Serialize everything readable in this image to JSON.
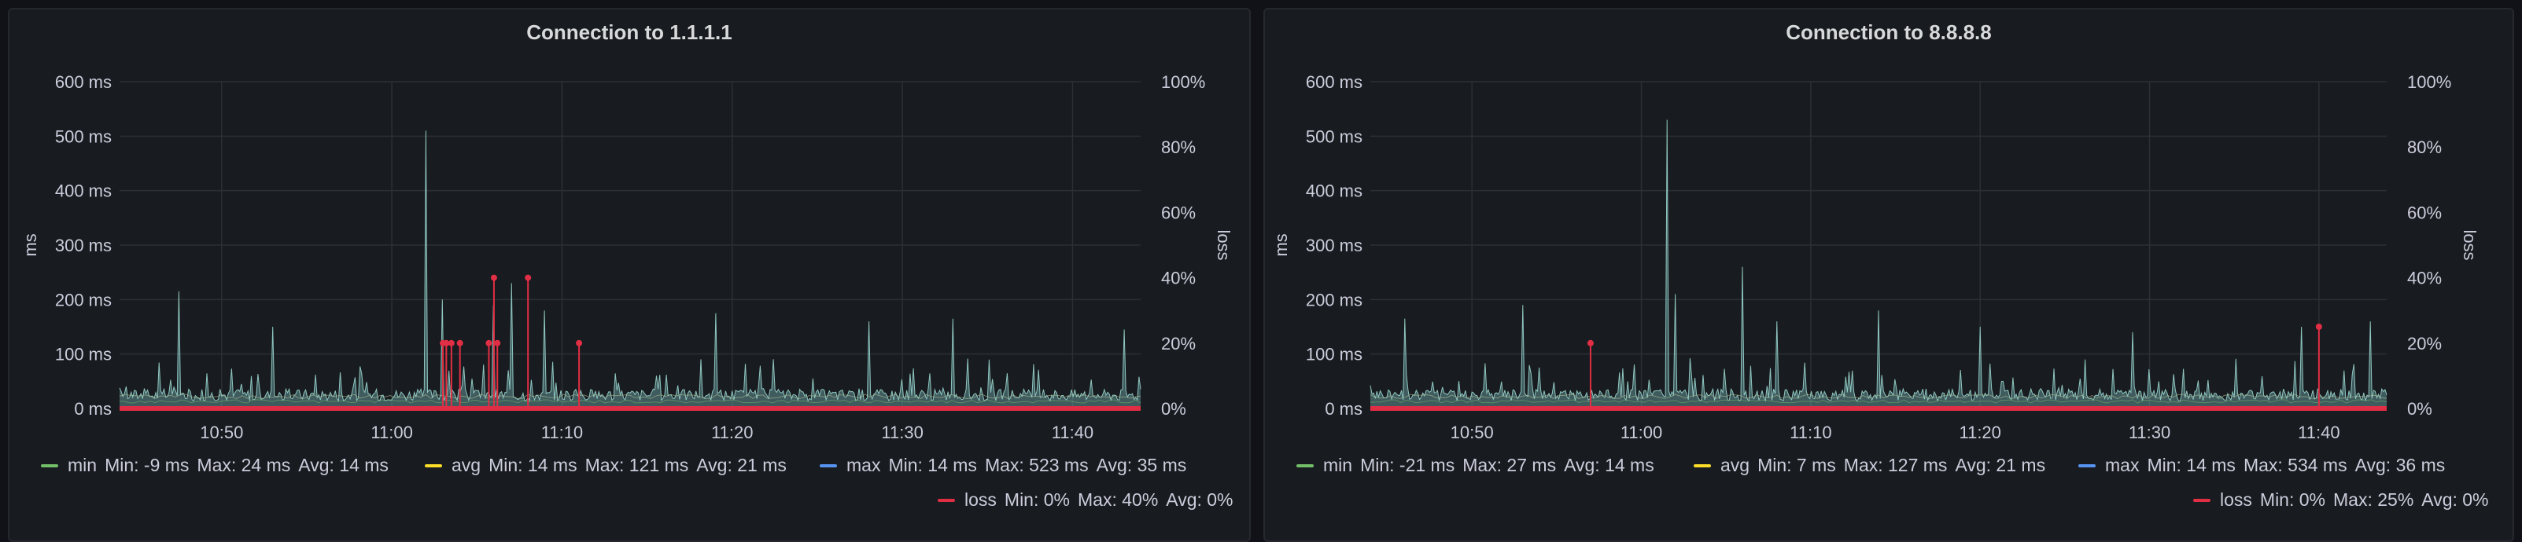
{
  "chart_data": [
    {
      "type": "line",
      "title": "Connection to 1.1.1.1",
      "ylabel": "ms",
      "y2label": "loss",
      "ylim": [
        0,
        600
      ],
      "y2lim": [
        0,
        100
      ],
      "y_ticks": [
        "0 ms",
        "100 ms",
        "200 ms",
        "300 ms",
        "400 ms",
        "500 ms",
        "600 ms"
      ],
      "y2_ticks": [
        "0%",
        "20%",
        "40%",
        "60%",
        "80%",
        "100%"
      ],
      "x_ticks": [
        "10:50",
        "11:00",
        "11:10",
        "11:20",
        "11:30",
        "11:40"
      ],
      "xlim_minutes": [
        "10:44",
        "11:44"
      ],
      "grid": true,
      "legend_placement": "bottom",
      "series": [
        {
          "name": "min",
          "color": "#73bf69",
          "legend": {
            "min": "Min: -9 ms",
            "max": "Max: 24 ms",
            "avg": "Avg: 14 ms"
          }
        },
        {
          "name": "avg",
          "color": "#fade2a",
          "legend": {
            "min": "Min: 14 ms",
            "max": "Max: 121 ms",
            "avg": "Avg: 21 ms"
          }
        },
        {
          "name": "max",
          "color": "#5794f2",
          "legend": {
            "min": "Min: 14 ms",
            "max": "Max: 523 ms",
            "avg": "Avg: 35 ms"
          }
        },
        {
          "name": "loss",
          "color": "#e02f44",
          "axis": "right",
          "legend": {
            "min": "Min: 0%",
            "max": "Max: 40%",
            "avg": "Avg: 0%"
          }
        }
      ],
      "max_spikes": [
        {
          "t": "10:47.5",
          "v": 215
        },
        {
          "t": "10:53",
          "v": 150
        },
        {
          "t": "11:02",
          "v": 510
        },
        {
          "t": "11:03",
          "v": 200
        },
        {
          "t": "11:06",
          "v": 190
        },
        {
          "t": "11:07",
          "v": 230
        },
        {
          "t": "11:09",
          "v": 180
        },
        {
          "t": "11:19",
          "v": 175
        },
        {
          "t": "11:28",
          "v": 160
        },
        {
          "t": "11:33",
          "v": 165
        },
        {
          "t": "11:43",
          "v": 145
        }
      ],
      "loss_points": [
        {
          "t": "11:03.0",
          "v": 20
        },
        {
          "t": "11:03.2",
          "v": 20
        },
        {
          "t": "11:03.5",
          "v": 20
        },
        {
          "t": "11:04",
          "v": 20
        },
        {
          "t": "11:05.7",
          "v": 20
        },
        {
          "t": "11:06",
          "v": 40
        },
        {
          "t": "11:06.2",
          "v": 20
        },
        {
          "t": "11:08",
          "v": 40
        },
        {
          "t": "11:11",
          "v": 20
        }
      ]
    },
    {
      "type": "line",
      "title": "Connection to 8.8.8.8",
      "ylabel": "ms",
      "y2label": "loss",
      "ylim": [
        0,
        600
      ],
      "y2lim": [
        0,
        100
      ],
      "y_ticks": [
        "0 ms",
        "100 ms",
        "200 ms",
        "300 ms",
        "400 ms",
        "500 ms",
        "600 ms"
      ],
      "y2_ticks": [
        "0%",
        "20%",
        "40%",
        "60%",
        "80%",
        "100%"
      ],
      "x_ticks": [
        "10:50",
        "11:00",
        "11:10",
        "11:20",
        "11:30",
        "11:40"
      ],
      "xlim_minutes": [
        "10:44",
        "11:44"
      ],
      "grid": true,
      "legend_placement": "bottom",
      "series": [
        {
          "name": "min",
          "color": "#73bf69",
          "legend": {
            "min": "Min: -21 ms",
            "max": "Max: 27 ms",
            "avg": "Avg: 14 ms"
          }
        },
        {
          "name": "avg",
          "color": "#fade2a",
          "legend": {
            "min": "Min: 7 ms",
            "max": "Max: 127 ms",
            "avg": "Avg: 21 ms"
          }
        },
        {
          "name": "max",
          "color": "#5794f2",
          "legend": {
            "min": "Min: 14 ms",
            "max": "Max: 534 ms",
            "avg": "Avg: 36 ms"
          }
        },
        {
          "name": "loss",
          "color": "#e02f44",
          "axis": "right",
          "legend": {
            "min": "Min: 0%",
            "max": "Max: 25%",
            "avg": "Avg: 0%"
          }
        }
      ],
      "max_spikes": [
        {
          "t": "10:46",
          "v": 165
        },
        {
          "t": "10:53",
          "v": 190
        },
        {
          "t": "11:01.5",
          "v": 530
        },
        {
          "t": "11:02",
          "v": 210
        },
        {
          "t": "11:06",
          "v": 260
        },
        {
          "t": "11:08",
          "v": 160
        },
        {
          "t": "11:14",
          "v": 180
        },
        {
          "t": "11:20",
          "v": 150
        },
        {
          "t": "11:29",
          "v": 140
        },
        {
          "t": "11:39",
          "v": 150
        },
        {
          "t": "11:43",
          "v": 160
        }
      ],
      "loss_points": [
        {
          "t": "10:57",
          "v": 20
        },
        {
          "t": "11:40",
          "v": 25
        }
      ]
    }
  ]
}
